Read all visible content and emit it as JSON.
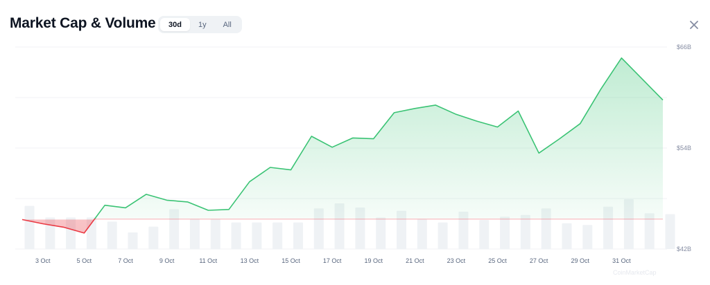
{
  "header": {
    "title": "Market Cap & Volume",
    "tabs": [
      {
        "label": "30d",
        "active": true
      },
      {
        "label": "1y",
        "active": false
      },
      {
        "label": "All",
        "active": false
      }
    ],
    "close_icon": "close-icon"
  },
  "watermark": "CoinMarketCap",
  "colors": {
    "up": "#3ac374",
    "down": "#ea3943",
    "volume_bar": "#eff2f5",
    "grid": "#f0f2f5"
  },
  "chart_data": {
    "type": "area",
    "baseline": 45.5,
    "ylim": [
      42,
      66
    ],
    "y_ticks": [
      {
        "value": 42,
        "label": "$42B"
      },
      {
        "value": 54,
        "label": "$54B"
      },
      {
        "value": 66,
        "label": "$66B"
      }
    ],
    "x_tick_labels": [
      "3 Oct",
      "5 Oct",
      "7 Oct",
      "9 Oct",
      "11 Oct",
      "13 Oct",
      "15 Oct",
      "17 Oct",
      "19 Oct",
      "21 Oct",
      "23 Oct",
      "25 Oct",
      "27 Oct",
      "29 Oct",
      "31 Oct"
    ],
    "market_cap_billions": [
      45.5,
      45.0,
      44.6,
      43.9,
      47.2,
      46.9,
      48.5,
      47.8,
      47.6,
      46.6,
      46.7,
      50.0,
      51.7,
      51.4,
      55.4,
      54.1,
      55.2,
      55.1,
      58.2,
      58.7,
      59.1,
      58.0,
      57.2,
      56.5,
      58.4,
      53.4,
      55.1,
      56.9,
      61.0,
      64.7,
      62.2,
      59.7
    ],
    "volume_relative": [
      0.52,
      0.38,
      0.38,
      0.38,
      0.33,
      0.2,
      0.27,
      0.48,
      0.36,
      0.36,
      0.32,
      0.32,
      0.32,
      0.32,
      0.49,
      0.55,
      0.5,
      0.38,
      0.46,
      0.36,
      0.32,
      0.45,
      0.35,
      0.39,
      0.41,
      0.49,
      0.31,
      0.29,
      0.51,
      0.6,
      0.43,
      0.42
    ]
  }
}
